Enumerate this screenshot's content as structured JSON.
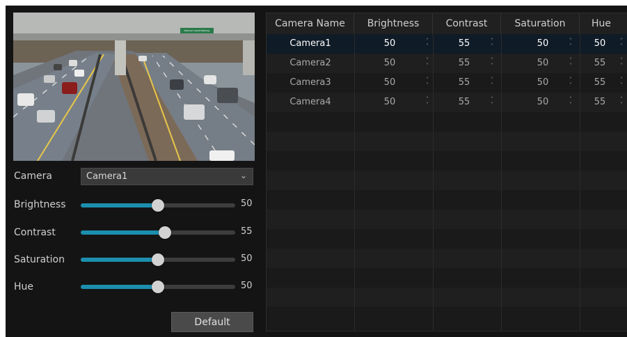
{
  "preview": {
    "sign_text": "National Capital Beltway"
  },
  "form": {
    "camera_label": "Camera",
    "camera_value": "Camera1",
    "sliders": [
      {
        "label": "Brightness",
        "value": "50",
        "fraction": 0.5
      },
      {
        "label": "Contrast",
        "value": "55",
        "fraction": 0.545
      },
      {
        "label": "Saturation",
        "value": "50",
        "fraction": 0.5
      },
      {
        "label": "Hue",
        "value": "50",
        "fraction": 0.5
      }
    ],
    "default_label": "Default"
  },
  "table": {
    "headers": [
      "Camera Name",
      "Brightness",
      "Contrast",
      "Saturation",
      "Hue"
    ],
    "rows": [
      {
        "name": "Camera1",
        "brightness": "50",
        "contrast": "55",
        "saturation": "50",
        "hue": "50"
      },
      {
        "name": "Camera2",
        "brightness": "50",
        "contrast": "55",
        "saturation": "50",
        "hue": "55"
      },
      {
        "name": "Camera3",
        "brightness": "50",
        "contrast": "55",
        "saturation": "50",
        "hue": "55"
      },
      {
        "name": "Camera4",
        "brightness": "50",
        "contrast": "55",
        "saturation": "50",
        "hue": "55"
      }
    ],
    "selected_row": 0
  },
  "colors": {
    "accent": "#1c8fae",
    "background": "#141414"
  }
}
